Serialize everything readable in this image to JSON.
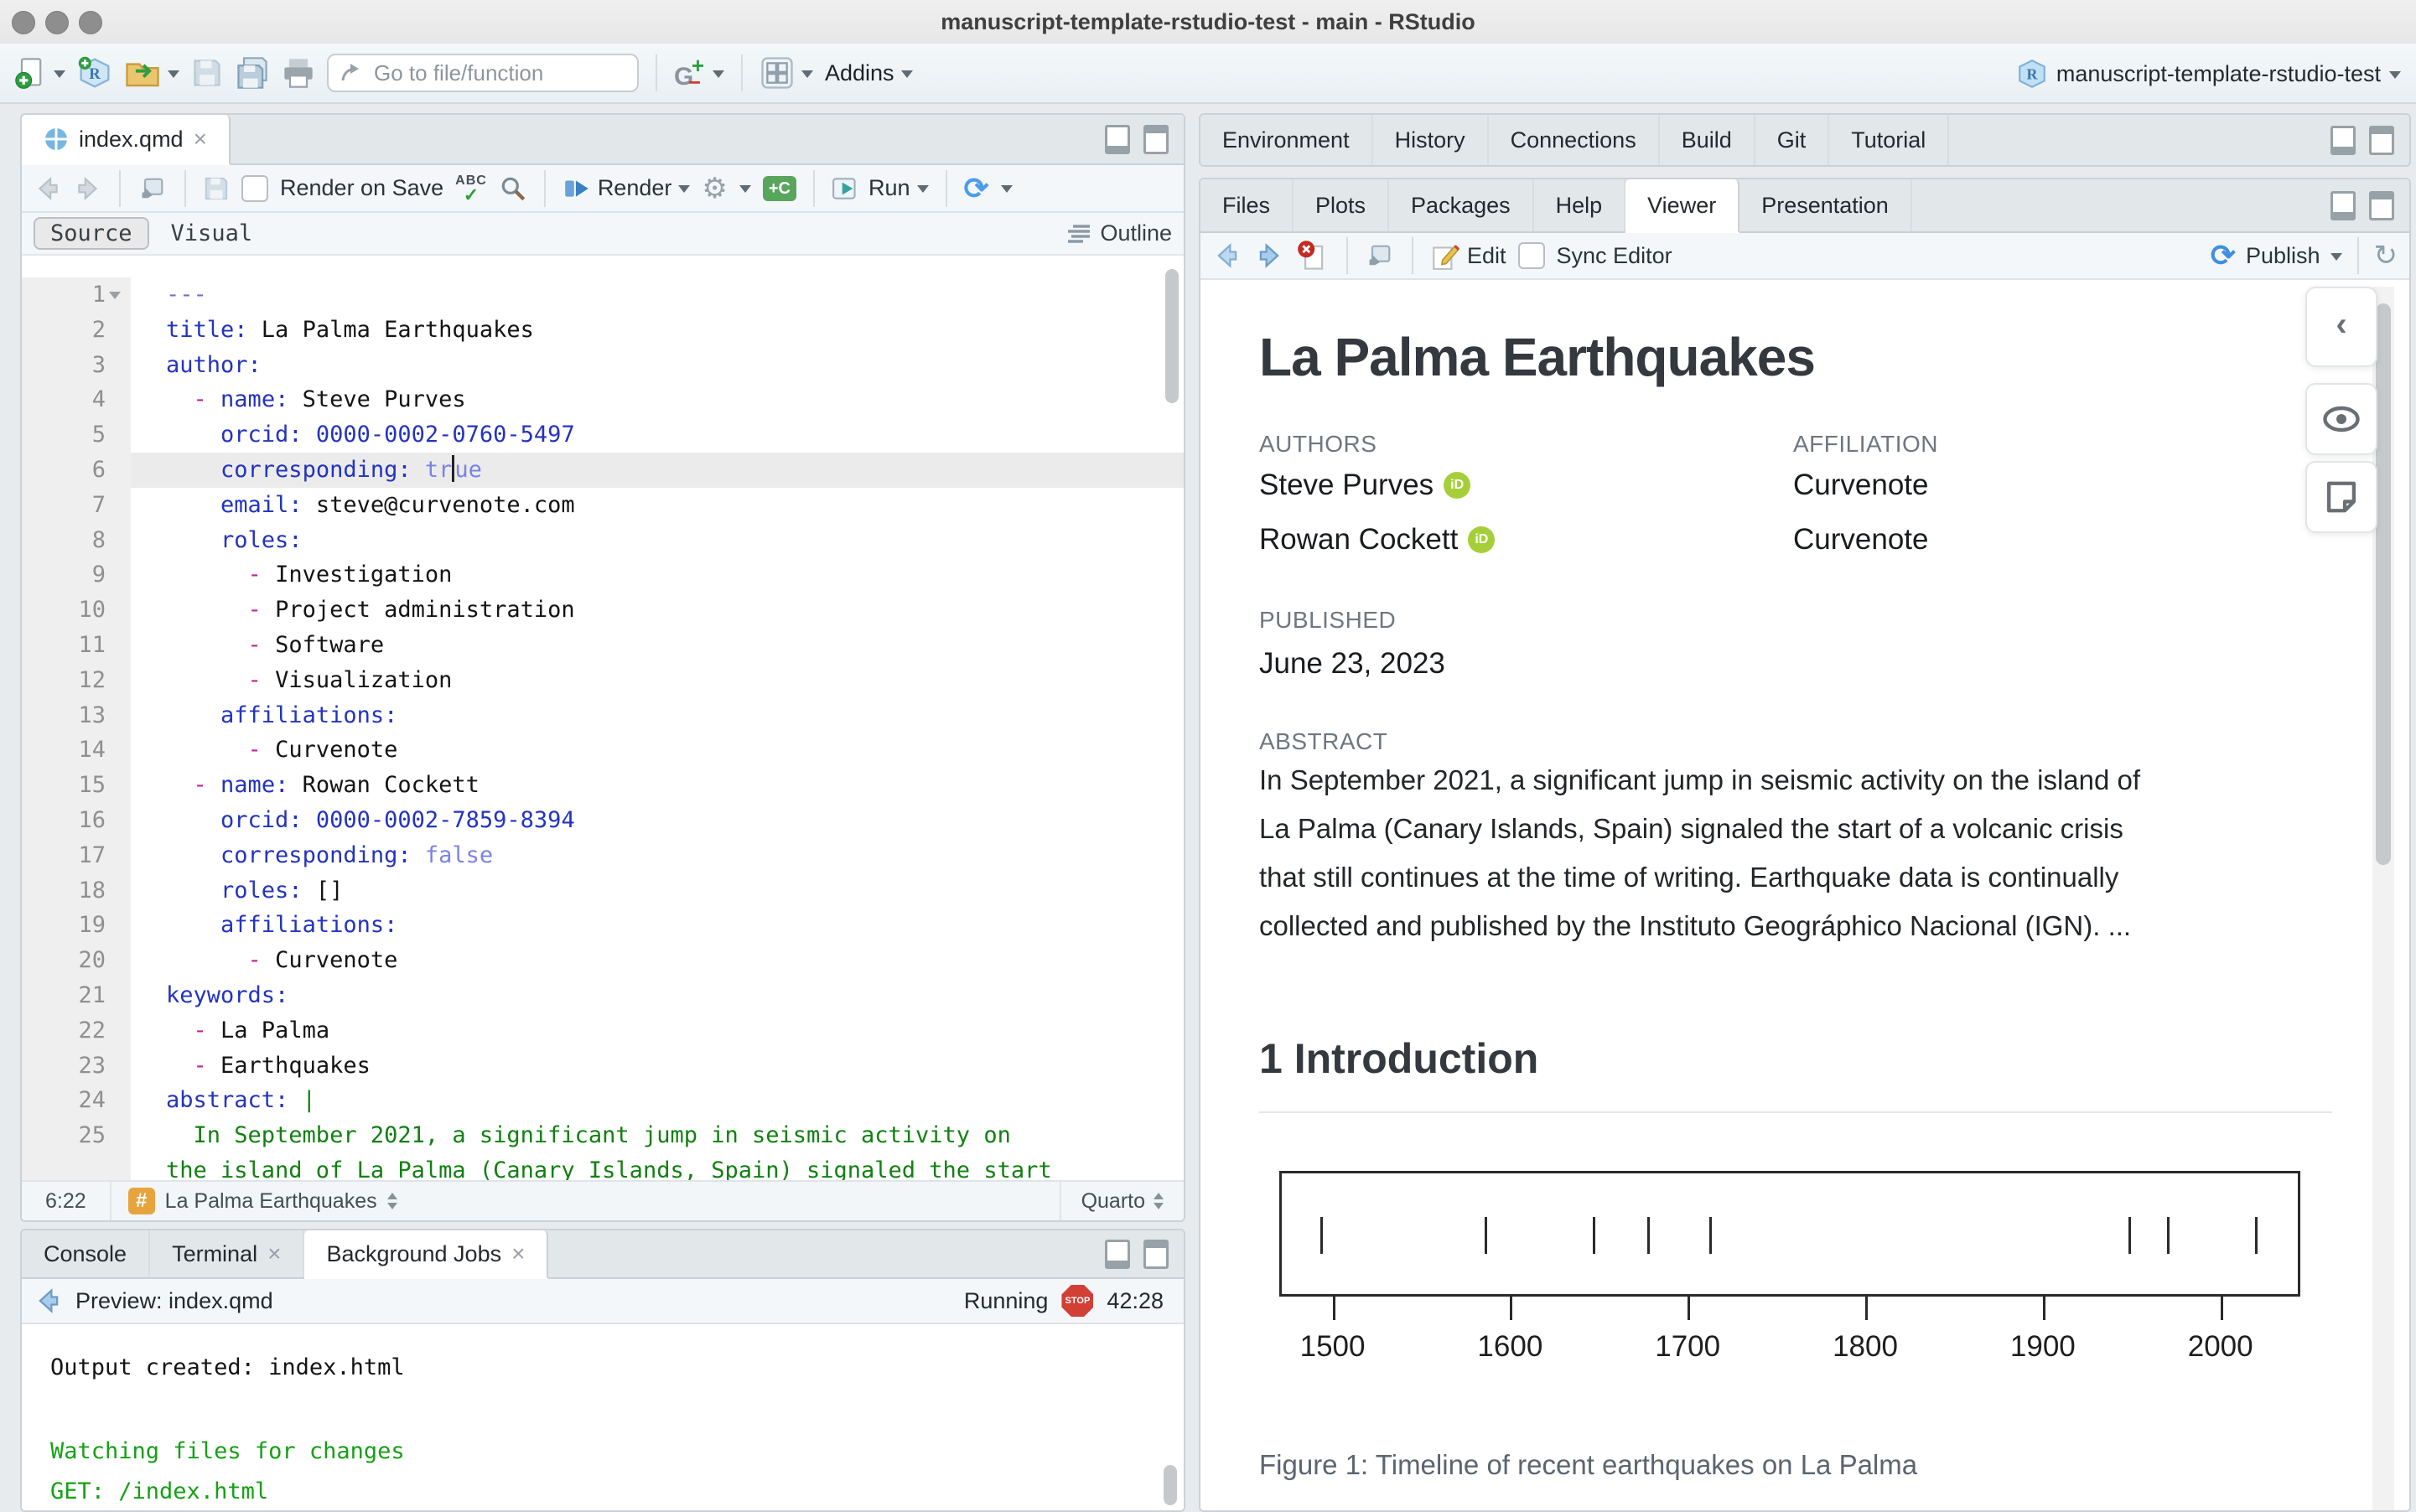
{
  "window": {
    "title": "manuscript-template-rstudio-test - main - RStudio"
  },
  "toolbar": {
    "goto_placeholder": "Go to file/function",
    "addins_label": "Addins",
    "project_label": "manuscript-template-rstudio-test"
  },
  "editor": {
    "tab_label": "index.qmd",
    "render_on_save_label": "Render on Save",
    "render_label": "Render",
    "run_label": "Run",
    "source_label": "Source",
    "visual_label": "Visual",
    "outline_label": "Outline",
    "status_position": "6:22",
    "status_symbol": "La Palma Earthquakes",
    "status_format": "Quarto",
    "lines": [
      {
        "n": "1",
        "fold": true,
        "t": [
          [
            "m",
            "---"
          ]
        ]
      },
      {
        "n": "2",
        "t": [
          [
            "k",
            "title:"
          ],
          [
            "p",
            " La Palma Earthquakes"
          ]
        ]
      },
      {
        "n": "3",
        "t": [
          [
            "k",
            "author:"
          ]
        ]
      },
      {
        "n": "4",
        "t": [
          [
            "p",
            "  "
          ],
          [
            "d",
            "-"
          ],
          [
            "p",
            " "
          ],
          [
            "k",
            "name:"
          ],
          [
            "p",
            " Steve Purves"
          ]
        ]
      },
      {
        "n": "5",
        "t": [
          [
            "p",
            "    "
          ],
          [
            "k",
            "orcid:"
          ],
          [
            "p",
            " "
          ],
          [
            "n2",
            "0000-0002-0760-5497"
          ]
        ]
      },
      {
        "n": "6",
        "cur": true,
        "t": [
          [
            "p",
            "    "
          ],
          [
            "k",
            "corresponding:"
          ],
          [
            "p",
            " "
          ],
          [
            "b",
            "tr"
          ],
          [
            "cursor",
            ""
          ],
          [
            "b",
            "ue"
          ]
        ]
      },
      {
        "n": "7",
        "t": [
          [
            "p",
            "    "
          ],
          [
            "k",
            "email:"
          ],
          [
            "p",
            " steve@curvenote.com"
          ]
        ]
      },
      {
        "n": "8",
        "t": [
          [
            "p",
            "    "
          ],
          [
            "k",
            "roles:"
          ]
        ]
      },
      {
        "n": "9",
        "t": [
          [
            "p",
            "      "
          ],
          [
            "d",
            "-"
          ],
          [
            "p",
            " Investigation"
          ]
        ]
      },
      {
        "n": "10",
        "t": [
          [
            "p",
            "      "
          ],
          [
            "d",
            "-"
          ],
          [
            "p",
            " Project administration"
          ]
        ]
      },
      {
        "n": "11",
        "t": [
          [
            "p",
            "      "
          ],
          [
            "d",
            "-"
          ],
          [
            "p",
            " Software"
          ]
        ]
      },
      {
        "n": "12",
        "t": [
          [
            "p",
            "      "
          ],
          [
            "d",
            "-"
          ],
          [
            "p",
            " Visualization"
          ]
        ]
      },
      {
        "n": "13",
        "t": [
          [
            "p",
            "    "
          ],
          [
            "k",
            "affiliations:"
          ]
        ]
      },
      {
        "n": "14",
        "t": [
          [
            "p",
            "      "
          ],
          [
            "d",
            "-"
          ],
          [
            "p",
            " Curvenote"
          ]
        ]
      },
      {
        "n": "15",
        "t": [
          [
            "p",
            "  "
          ],
          [
            "d",
            "-"
          ],
          [
            "p",
            " "
          ],
          [
            "k",
            "name:"
          ],
          [
            "p",
            " Rowan Cockett"
          ]
        ]
      },
      {
        "n": "16",
        "t": [
          [
            "p",
            "    "
          ],
          [
            "k",
            "orcid:"
          ],
          [
            "p",
            " "
          ],
          [
            "n2",
            "0000-0002-7859-8394"
          ]
        ]
      },
      {
        "n": "17",
        "t": [
          [
            "p",
            "    "
          ],
          [
            "k",
            "corresponding:"
          ],
          [
            "p",
            " "
          ],
          [
            "b",
            "false"
          ]
        ]
      },
      {
        "n": "18",
        "t": [
          [
            "p",
            "    "
          ],
          [
            "k",
            "roles:"
          ],
          [
            "p",
            " []"
          ]
        ]
      },
      {
        "n": "19",
        "t": [
          [
            "p",
            "    "
          ],
          [
            "k",
            "affiliations:"
          ]
        ]
      },
      {
        "n": "20",
        "t": [
          [
            "p",
            "      "
          ],
          [
            "d",
            "-"
          ],
          [
            "p",
            " Curvenote"
          ]
        ]
      },
      {
        "n": "21",
        "t": [
          [
            "k",
            "keywords:"
          ]
        ]
      },
      {
        "n": "22",
        "t": [
          [
            "p",
            "  "
          ],
          [
            "d",
            "-"
          ],
          [
            "p",
            " La Palma"
          ]
        ]
      },
      {
        "n": "23",
        "t": [
          [
            "p",
            "  "
          ],
          [
            "d",
            "-"
          ],
          [
            "p",
            " Earthquakes"
          ]
        ]
      },
      {
        "n": "24",
        "t": [
          [
            "k",
            "abstract:"
          ],
          [
            "p",
            " "
          ],
          [
            "g",
            "|"
          ]
        ]
      },
      {
        "n": "25",
        "t": [
          [
            "g",
            "  In September 2021, a significant jump in seismic activity on"
          ]
        ]
      },
      {
        "n": "",
        "t": [
          [
            "g",
            "the island of La Palma (Canary Islands, Spain) signaled the start"
          ]
        ]
      }
    ]
  },
  "console": {
    "tabs": [
      "Console",
      "Terminal",
      "Background Jobs"
    ],
    "preview_label": "Preview: index.qmd",
    "running_label": "Running",
    "stop_label": "STOP",
    "elapsed": "42:28",
    "output": [
      {
        "text": "Output created: index.html",
        "style": "dark",
        "gap_after": true
      },
      {
        "text": "Watching files for changes",
        "style": "green"
      },
      {
        "text": "GET: /index.html",
        "style": "green"
      }
    ]
  },
  "right_top_tabs": [
    "Environment",
    "History",
    "Connections",
    "Build",
    "Git",
    "Tutorial"
  ],
  "viewer_tabs": [
    "Files",
    "Plots",
    "Packages",
    "Help",
    "Viewer",
    "Presentation"
  ],
  "viewer_toolbar": {
    "edit_label": "Edit",
    "sync_label": "Sync Editor",
    "publish_label": "Publish"
  },
  "document": {
    "title": "La Palma Earthquakes",
    "authors_label": "AUTHORS",
    "affiliation_label": "AFFILIATION",
    "authors": [
      {
        "name": "Steve Purves",
        "affiliation": "Curvenote"
      },
      {
        "name": "Rowan Cockett",
        "affiliation": "Curvenote"
      }
    ],
    "published_label": "PUBLISHED",
    "published_date": "June 23, 2023",
    "abstract_label": "ABSTRACT",
    "abstract_lines": [
      "In September 2021, a significant jump in seismic activity on the island of",
      "La Palma (Canary Islands, Spain) signaled the start of a volcanic crisis",
      "that still continues at the time of writing. Earthquake data is continually",
      "collected and published by the Instituto Geográphico Nacional (IGN). ..."
    ],
    "section_heading": "1 Introduction",
    "figure_caption": "Figure 1: Timeline of recent earthquakes on La Palma"
  },
  "chart_data": {
    "type": "rug",
    "title": "Timeline of recent earthquakes on La Palma",
    "x_events_years": [
      1492,
      1585,
      1646,
      1677,
      1712,
      1949,
      1971,
      2021
    ],
    "xticks": [
      1500,
      1600,
      1700,
      1800,
      1900,
      2000
    ],
    "xlim": [
      1470,
      2045
    ],
    "xlabel": "",
    "caption": "Figure 1: Timeline of recent earthquakes on La Palma"
  },
  "colors": {
    "accent_blue": "#4c9ced",
    "yaml_key_blue": "#2333c1",
    "yaml_bool_violet": "#7a82e8",
    "yaml_dash_magenta": "#c2209a",
    "string_green": "#118011",
    "orcid_green": "#a6ce39",
    "stop_red": "#d23f35",
    "chunk_green": "#58a55c"
  }
}
